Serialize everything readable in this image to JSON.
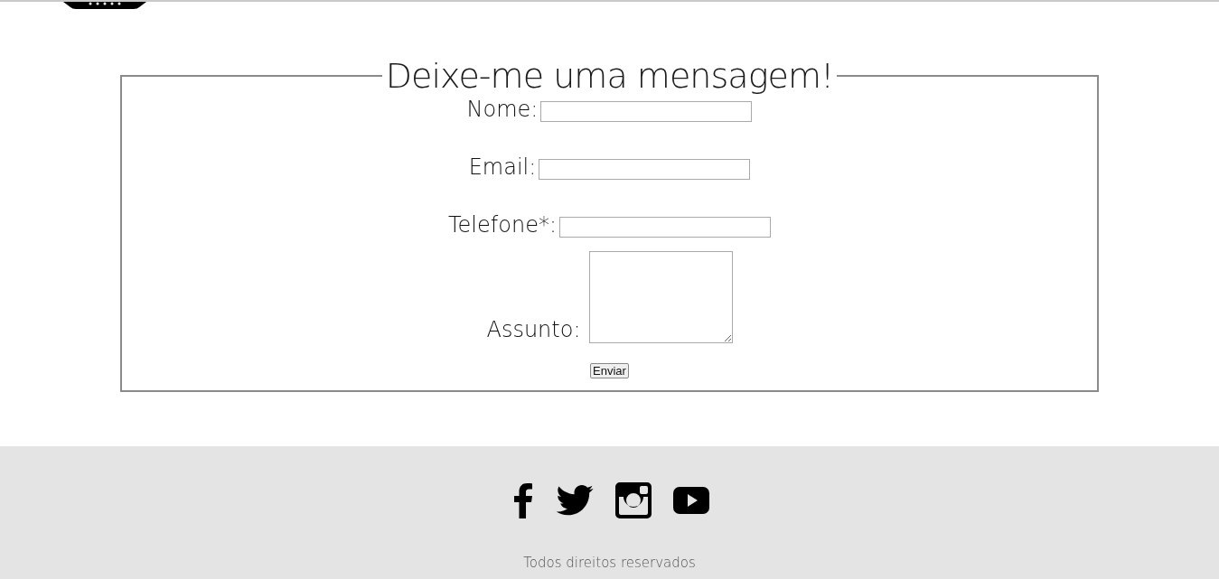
{
  "form": {
    "legend": "Deixe-me uma mensagem!",
    "fields": [
      {
        "kind": "text",
        "label": "Nome:"
      },
      {
        "kind": "text",
        "label": "Email:"
      },
      {
        "kind": "text",
        "label": "Telefone*:"
      },
      {
        "kind": "textarea",
        "label": "Assunto:"
      }
    ],
    "submit": "Enviar"
  },
  "footer": {
    "social": [
      {
        "kind": "facebook"
      },
      {
        "kind": "twitter"
      },
      {
        "kind": "instagram"
      },
      {
        "kind": "youtube"
      }
    ],
    "copyright": "Todos direitos reservados"
  }
}
